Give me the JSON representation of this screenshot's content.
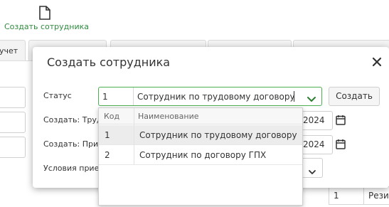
{
  "toolbar": {
    "create_employee_label": "Создать сотрудника",
    "icon": "document-icon"
  },
  "background": {
    "tab_partial_label": "учет",
    "row_code": "1",
    "row_name_partial": "Рези"
  },
  "modal": {
    "title": "Создать сотрудника",
    "close_icon": "close-icon",
    "status_label": "Статус",
    "status_code": "1",
    "status_value": "Сотрудник по трудовому договору",
    "create_button": "Создать",
    "create_labor_label": "Создать: Труд",
    "create_order_label": "Создать: Прик",
    "conditions_label": "Условия прие",
    "date1_partial": "2024",
    "date2_partial": "2024"
  },
  "dropdown": {
    "columns": {
      "code": "Код",
      "name": "Наименование"
    },
    "rows": [
      {
        "code": "1",
        "name": "Сотрудник по трудовому договору",
        "selected": true
      },
      {
        "code": "2",
        "name": "Сотрудник по договору ГПХ",
        "selected": false
      }
    ]
  },
  "colors": {
    "accent_green": "#4caf50",
    "toolbar_green": "#2e8b3d"
  }
}
